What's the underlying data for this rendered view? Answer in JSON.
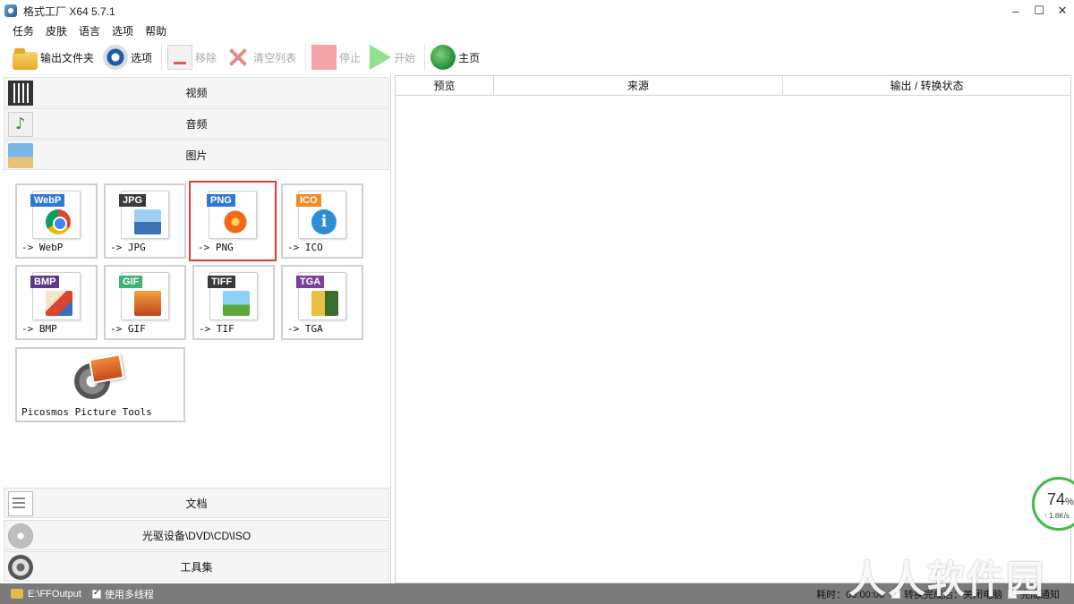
{
  "window": {
    "title": "格式工厂 X64 5.7.1",
    "minimize": "–",
    "maximize": "☐",
    "close": "✕"
  },
  "menu": [
    "任务",
    "皮肤",
    "语言",
    "选项",
    "帮助"
  ],
  "toolbar": {
    "output_folder": "输出文件夹",
    "options": "选项",
    "remove": "移除",
    "clear_list": "清空列表",
    "stop": "停止",
    "start": "开始",
    "home": "主页"
  },
  "categories": {
    "video": "视频",
    "audio": "音频",
    "picture": "图片",
    "document": "文档",
    "disc": "光驱设备\\DVD\\CD\\ISO",
    "tools": "工具集"
  },
  "image_formats": [
    {
      "badge": "WebP",
      "label": "-> WebP",
      "color": "#2f79d4",
      "selected": false
    },
    {
      "badge": "JPG",
      "label": "-> JPG",
      "color": "#3a3a3a",
      "selected": false
    },
    {
      "badge": "PNG",
      "label": "-> PNG",
      "color": "#2f79d4",
      "selected": true
    },
    {
      "badge": "ICO",
      "label": "-> ICO",
      "color": "#f08a24",
      "selected": false
    },
    {
      "badge": "BMP",
      "label": "-> BMP",
      "color": "#5b3a8c",
      "selected": false
    },
    {
      "badge": "GIF",
      "label": "-> GIF",
      "color": "#3cb371",
      "selected": false
    },
    {
      "badge": "TIFF",
      "label": "-> TIF",
      "color": "#3a3a3a",
      "selected": false
    },
    {
      "badge": "TGA",
      "label": "-> TGA",
      "color": "#7b3fa0",
      "selected": false
    }
  ],
  "picosmos": {
    "label": "Picosmos Picture Tools"
  },
  "task_list": {
    "columns": [
      "预览",
      "来源",
      "输出 / 转换状态"
    ]
  },
  "net_monitor": {
    "percent": "74",
    "percent_sign": "%",
    "speed": "1.8K/s",
    "arrow": "↑"
  },
  "statusbar": {
    "output_path": "E:\\FFOutput",
    "multithread": "使用多线程",
    "elapsed": "耗时：00:00:00",
    "after_convert": "转换完成后：关闭电脑",
    "notify": "完成通知"
  },
  "watermark": "人人软件园"
}
